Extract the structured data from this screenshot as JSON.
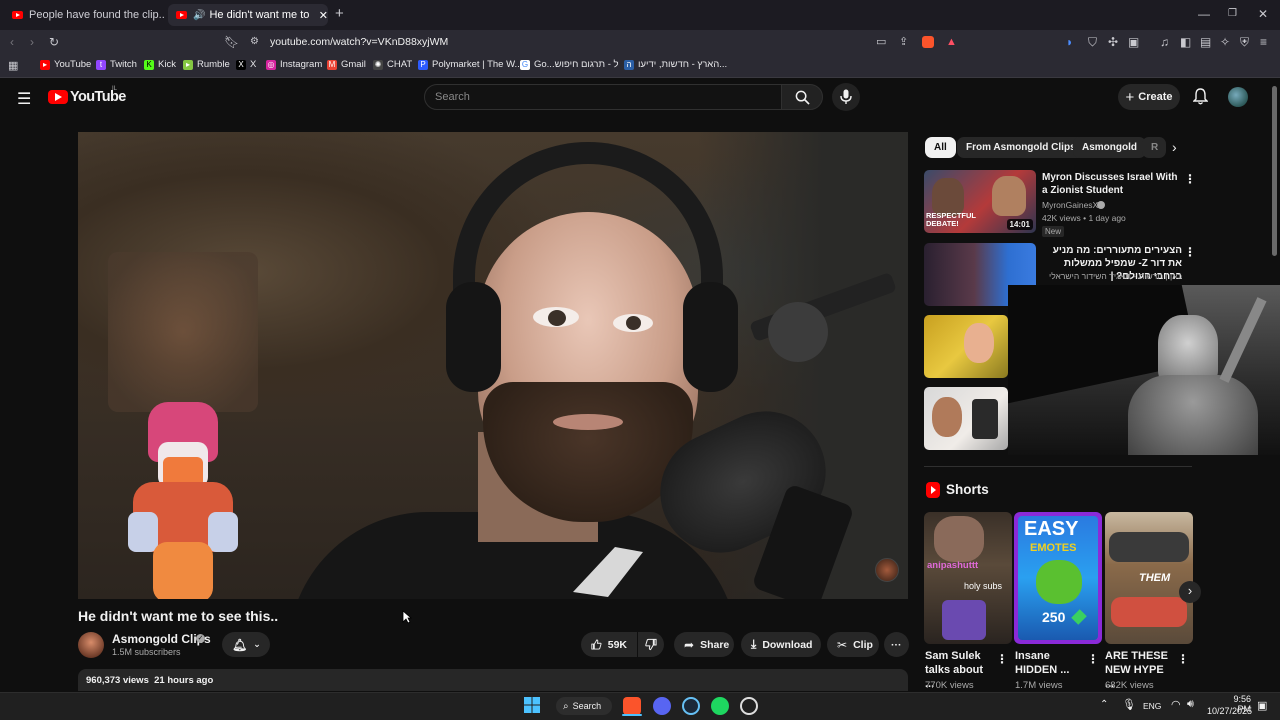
{
  "browser": {
    "tabs": [
      {
        "title": "People have found the clip... - YouTu"
      },
      {
        "title": "He didn't want me to see this"
      }
    ],
    "url": "youtube.com/watch?v=VKnD88xyjWM",
    "bookmarks": [
      "YouTube",
      "Twitch",
      "Kick",
      "Rumble",
      "X",
      "Instagram",
      "Gmail",
      "CHAT",
      "Polymarket | The W...",
      "Go...ל - תרגום חיפוש",
      "הארץ - חדשות, ידיעו..."
    ]
  },
  "yt": {
    "logo": "YouTube",
    "country": "IL",
    "search_placeholder": "Search",
    "create_label": "Create"
  },
  "video": {
    "title": "He didn't want me to see this..",
    "channel": "Asmongold Clips",
    "subscribers": "1.5M subscribers",
    "likes": "59K",
    "share_label": "Share",
    "download_label": "Download",
    "clip_label": "Clip",
    "views_date": "960,373 views  21 hours ago"
  },
  "sidebar": {
    "chips": [
      "All",
      "From Asmongold Clips",
      "Asmongold",
      "R"
    ],
    "recs": [
      {
        "title": "Myron Discusses Israel With a Zionist Student",
        "channel": "MyronGainesX",
        "meta": "42K views • 1 day ago",
        "badge": "New",
        "duration": "14:01",
        "thumb_text": "RESPECTFUL DEBATE!"
      },
      {
        "title": "הצעירים מתעוררים: מה מניע את דור Z- שמפיל ממשלות ברחבי העולם? |",
        "channel": "כאן | חדשות - תאגיד השידור הישראלי"
      }
    ],
    "shorts_label": "Shorts",
    "shorts": [
      {
        "title": "Sam Sulek talks about ...",
        "views": "770K views",
        "overlay_user": "anipashuttt",
        "overlay_msg": "holy subs"
      },
      {
        "title": "Insane HIDDEN ...",
        "views": "1.7M views",
        "thumb_top": "EASY",
        "thumb_sub": "EMOTES",
        "thumb_price": "250"
      },
      {
        "title": "ARE THESE NEW HYPE ...",
        "views": "682K views",
        "thumb_text": "THEM"
      }
    ]
  },
  "taskbar": {
    "search_label": "Search",
    "lang": "ENG",
    "time": "9:56 PM",
    "date": "10/27/2025"
  },
  "colors": {
    "accent": "#ff0000",
    "bg": "#0f0f0f",
    "pill": "#272727"
  }
}
